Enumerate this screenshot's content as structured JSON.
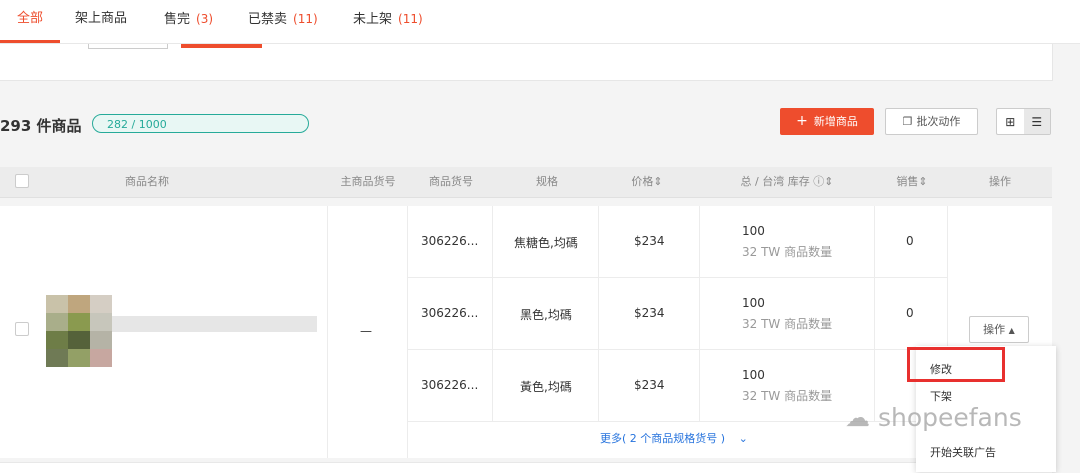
{
  "tabs": [
    {
      "label": "全部",
      "count": ""
    },
    {
      "label": "架上商品",
      "count": ""
    },
    {
      "label": "售完",
      "count": "(3)"
    },
    {
      "label": "已禁卖",
      "count": "(11)"
    },
    {
      "label": "未上架",
      "count": "(11)"
    }
  ],
  "toolbar": {
    "product_count": "293 件商品",
    "quota": "282 / 1000",
    "add_button": "新增商品",
    "batch_button": "批次动作"
  },
  "table": {
    "headers": {
      "name": "商品名称",
      "parent_sku": "主商品货号",
      "sku": "商品货号",
      "variation": "规格",
      "price": "价格",
      "stock": "总 / 台湾 库存",
      "sales": "销售",
      "actions": "操作"
    },
    "product": {
      "parent_sku": "—",
      "variants": [
        {
          "sku": "306226...",
          "variation": "焦糖色,均碼",
          "price": "$234",
          "stock_total": "100",
          "stock_tw": "32 TW 商品数量",
          "sales": "0"
        },
        {
          "sku": "306226...",
          "variation": "黑色,均碼",
          "price": "$234",
          "stock_total": "100",
          "stock_tw": "32 TW 商品数量",
          "sales": "0"
        },
        {
          "sku": "306226...",
          "variation": "黃色,均碼",
          "price": "$234",
          "stock_total": "100",
          "stock_tw": "32 TW 商品数量",
          "sales": ""
        }
      ],
      "more_link": "更多( 2 个商品规格货号 )"
    },
    "action_button": "操作"
  },
  "dropdown": {
    "items": [
      "修改",
      "下架",
      "",
      "开始关联广告"
    ]
  },
  "watermark": "shopeefans",
  "colors": {
    "accent": "#ee4d2d",
    "quota": "#26aa99",
    "link": "#2673dd",
    "highlight": "#e8302e"
  },
  "icons": {
    "add": "plus-icon",
    "batch": "copy-icon",
    "grid_view": "grid-icon",
    "list_view": "list-icon",
    "sort": "sort-icon",
    "info": "info-icon",
    "dropdown_arrow": "caret-up-icon",
    "more_arrow": "chevron-down-icon",
    "watermark_logo": "wechat-icon"
  }
}
